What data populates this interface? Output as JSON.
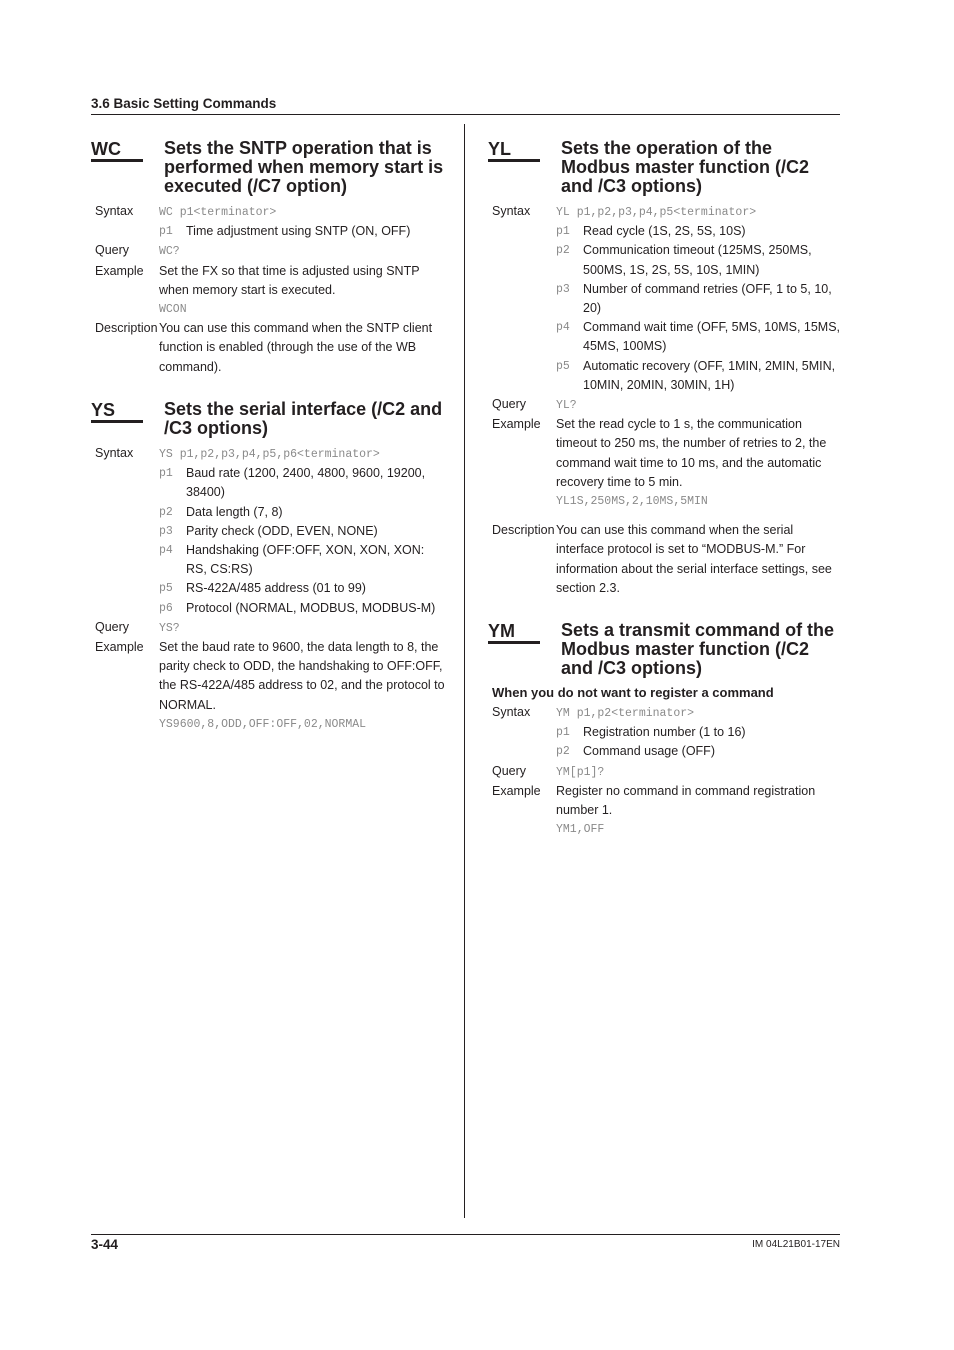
{
  "header": {
    "section": "3.6  Basic Setting Commands"
  },
  "footer": {
    "page": "3-44",
    "doc_id": "IM 04L21B01-17EN"
  },
  "labels": {
    "syntax": "Syntax",
    "query": "Query",
    "example": "Example",
    "description": "Description"
  },
  "wc": {
    "code": "WC",
    "title": "Sets the SNTP operation that is performed when memory start is executed (/C7 option)",
    "syntax": "WC p1<terminator>",
    "params": [
      {
        "name": "p1",
        "desc": "Time adjustment using SNTP (ON, OFF)"
      }
    ],
    "query": "WC?",
    "example_text": "Set the FX so that time is adjusted using SNTP when memory start is executed.",
    "example_code": "WCON",
    "description": "You can use this command when the SNTP client function is enabled (through the use of the WB command)."
  },
  "ys": {
    "code": "YS",
    "title": "Sets the serial interface (/C2 and /C3 options)",
    "syntax": "YS p1,p2,p3,p4,p5,p6<terminator>",
    "params": [
      {
        "name": "p1",
        "desc": "Baud rate (1200, 2400, 4800, 9600, 19200, 38400)"
      },
      {
        "name": "p2",
        "desc": "Data length (7, 8)"
      },
      {
        "name": "p3",
        "desc": "Parity check (ODD, EVEN, NONE)"
      },
      {
        "name": "p4",
        "desc": "Handshaking (OFF:OFF, XON, XON, XON: RS, CS:RS)"
      },
      {
        "name": "p5",
        "desc": "RS-422A/485 address (01 to 99)"
      },
      {
        "name": "p6",
        "desc": "Protocol (NORMAL, MODBUS, MODBUS-M)"
      }
    ],
    "query": "YS?",
    "example_text": "Set the baud rate to 9600, the data length to 8, the parity check to ODD, the handshaking to OFF:OFF, the RS-422A/485 address to 02, and the protocol to NORMAL.",
    "example_code": "YS9600,8,ODD,OFF:OFF,02,NORMAL"
  },
  "yl": {
    "code": "YL",
    "title": "Sets the operation of the Modbus master function (/C2 and /C3 options)",
    "syntax": "YL p1,p2,p3,p4,p5<terminator>",
    "params": [
      {
        "name": "p1",
        "desc": "Read cycle (1S, 2S, 5S, 10S)"
      },
      {
        "name": "p2",
        "desc": "Communication timeout (125MS, 250MS, 500MS, 1S, 2S, 5S, 10S, 1MIN)"
      },
      {
        "name": "p3",
        "desc": "Number of command retries (OFF, 1 to 5, 10, 20)"
      },
      {
        "name": "p4",
        "desc": "Command wait time (OFF, 5MS, 10MS, 15MS, 45MS, 100MS)"
      },
      {
        "name": "p5",
        "desc": "Automatic recovery (OFF, 1MIN, 2MIN, 5MIN, 10MIN, 20MIN, 30MIN, 1H)"
      }
    ],
    "query": "YL?",
    "example_text": "Set the read cycle to 1 s, the communication timeout to 250 ms, the number of retries to 2, the command wait time to 10 ms, and the automatic recovery time to 5 min.",
    "example_code": "YL1S,250MS,2,10MS,5MIN",
    "description": "You can use this command when the serial interface protocol is set to “MODBUS-M.” For information about the serial interface settings, see section 2.3."
  },
  "ym": {
    "code": "YM",
    "title": "Sets a transmit command of the Modbus master function (/C2 and /C3 options)",
    "subheading": "When you do not want to register a command",
    "syntax": "YM p1,p2<terminator>",
    "params": [
      {
        "name": "p1",
        "desc": "Registration number (1 to 16)"
      },
      {
        "name": "p2",
        "desc": "Command usage (OFF)"
      }
    ],
    "query": "YM[p1]?",
    "example_text": "Register no command in command registration number 1.",
    "example_code": "YM1,OFF"
  }
}
